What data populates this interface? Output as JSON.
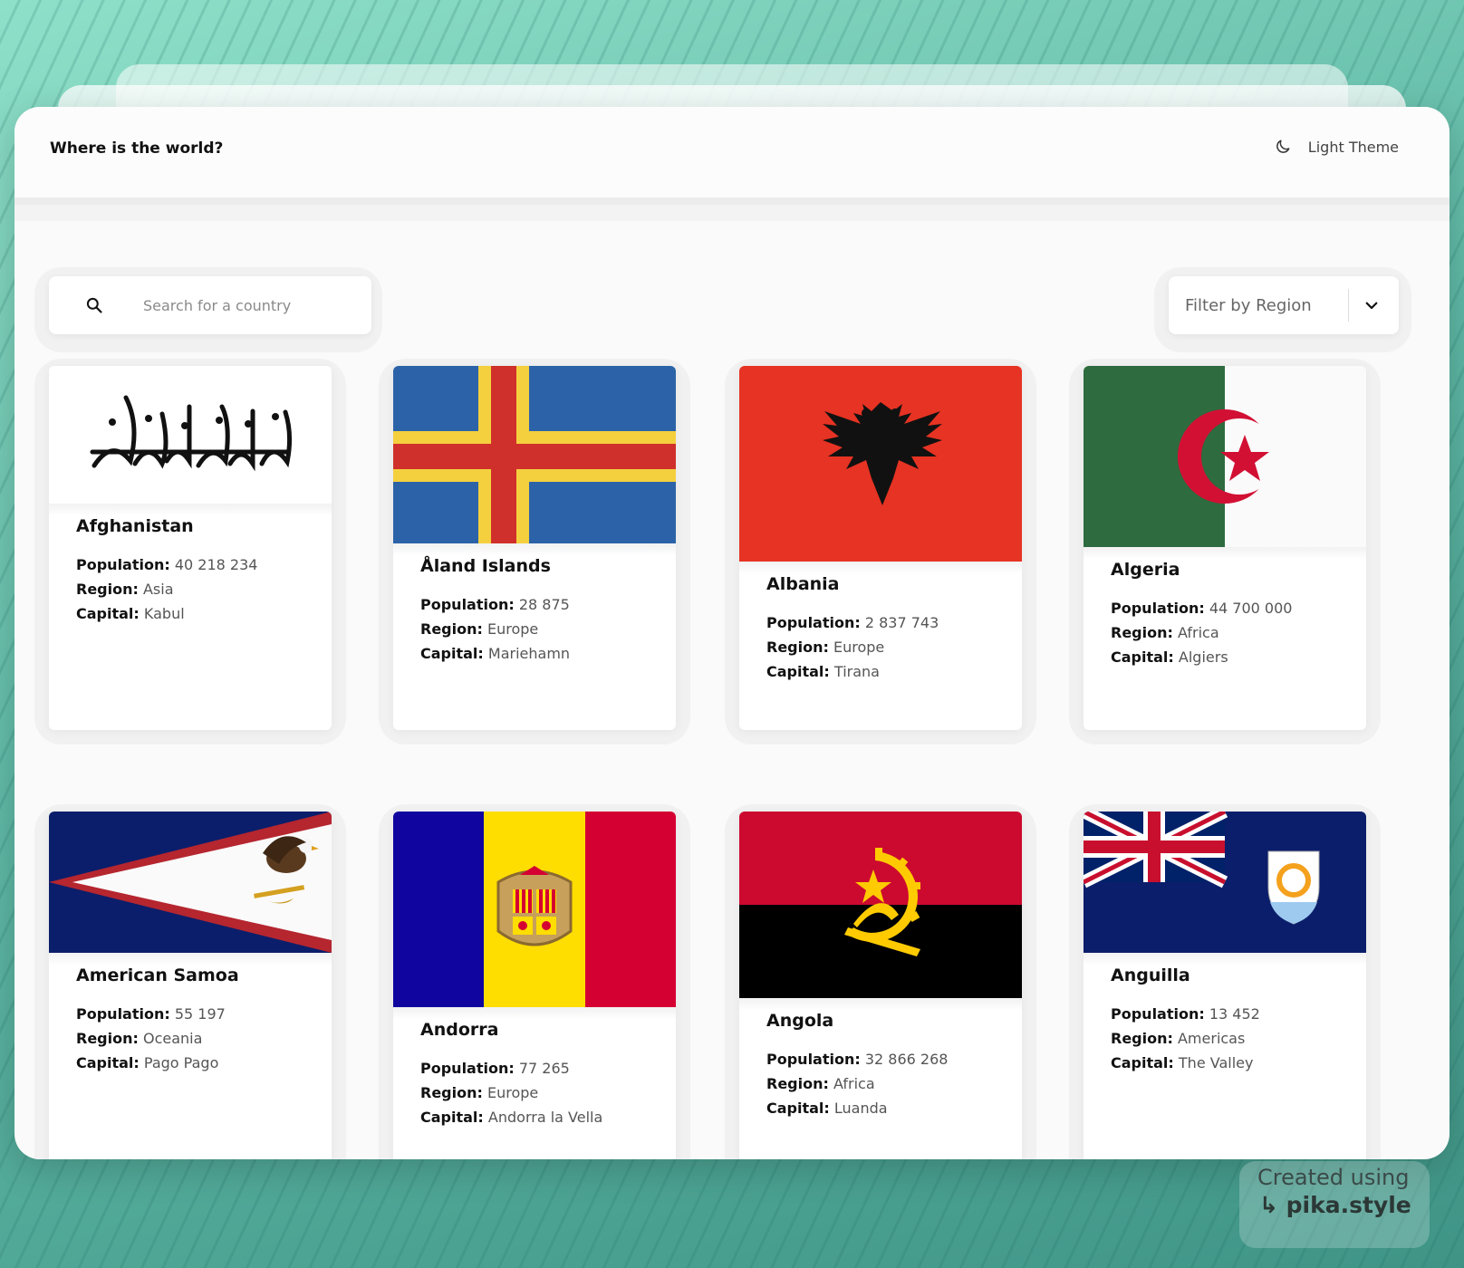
{
  "header": {
    "title": "Where is the world?",
    "theme_label": "Light Theme",
    "theme_icon": "moon-icon"
  },
  "search": {
    "placeholder": "Search for a country",
    "value": ""
  },
  "filter": {
    "label": "Filter by Region"
  },
  "labels": {
    "population": "Population:",
    "region": "Region:",
    "capital": "Capital:"
  },
  "countries": [
    {
      "name": "Afghanistan",
      "population": "40 218 234",
      "region": "Asia",
      "capital": "Kabul"
    },
    {
      "name": "Åland Islands",
      "population": "28 875",
      "region": "Europe",
      "capital": "Mariehamn"
    },
    {
      "name": "Albania",
      "population": "2 837 743",
      "region": "Europe",
      "capital": "Tirana"
    },
    {
      "name": "Algeria",
      "population": "44 700 000",
      "region": "Africa",
      "capital": "Algiers"
    },
    {
      "name": "American Samoa",
      "population": "55 197",
      "region": "Oceania",
      "capital": "Pago Pago"
    },
    {
      "name": "Andorra",
      "population": "77 265",
      "region": "Europe",
      "capital": "Andorra la Vella"
    },
    {
      "name": "Angola",
      "population": "32 866 268",
      "region": "Africa",
      "capital": "Luanda"
    },
    {
      "name": "Anguilla",
      "population": "13 452",
      "region": "Americas",
      "capital": "The Valley"
    }
  ],
  "watermark": {
    "line1": "Created using",
    "line2": "↳ pika.style"
  }
}
